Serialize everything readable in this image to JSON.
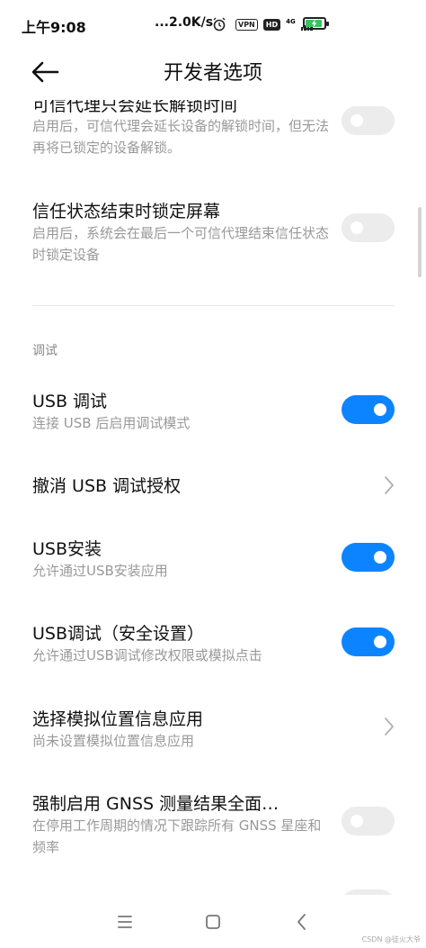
{
  "status_bar": {
    "time": "上午9:08",
    "net_speed": "...2.0K/s",
    "vpn": "VPN",
    "hd": "HD",
    "network": "4G"
  },
  "header": {
    "title": "开发者选项"
  },
  "settings": [
    {
      "title": "可信代理只会延长解锁时间",
      "subtitle": "启用后，可信代理会延长设备的解锁时间，但无法再将已锁定的设备解锁。",
      "control": "toggle",
      "enabled": false
    },
    {
      "title": "信任状态结束时锁定屏幕",
      "subtitle": "启用后，系统会在最后一个可信代理结束信任状态时锁定设备",
      "control": "toggle",
      "enabled": false
    },
    {
      "title": "USB 调试",
      "subtitle": "连接 USB 后启用调试模式",
      "control": "toggle",
      "enabled": true
    },
    {
      "title": "撤消 USB 调试授权",
      "subtitle": "",
      "control": "chevron"
    },
    {
      "title": "USB安装",
      "subtitle": "允许通过USB安装应用",
      "control": "toggle",
      "enabled": true
    },
    {
      "title": "USB调试（安全设置）",
      "subtitle": "允许通过USB调试修改权限或模拟点击",
      "control": "toggle",
      "enabled": true
    },
    {
      "title": "选择模拟位置信息应用",
      "subtitle": "尚未设置模拟位置信息应用",
      "control": "chevron"
    },
    {
      "title": "强制启用 GNSS 测量结果全面…",
      "subtitle": "在停用工作周期的情况下跟踪所有 GNSS 星座和频率",
      "control": "toggle",
      "enabled": false
    }
  ],
  "section": {
    "debug_label": "调试"
  },
  "watermark": "CSDN @徒火大爷",
  "colors": {
    "accent": "#0d84ff",
    "toggle_off": "#ececec",
    "subtitle": "#999999"
  }
}
